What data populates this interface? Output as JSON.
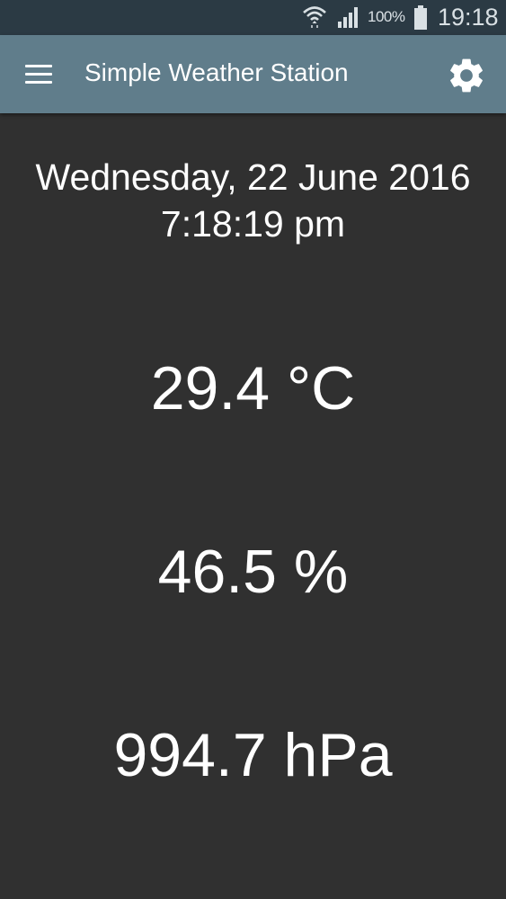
{
  "status_bar": {
    "battery_percent": "100%",
    "time": "19:18",
    "icons": [
      "wifi-icon",
      "signal-icon",
      "battery-icon"
    ]
  },
  "app_bar": {
    "title": "Simple Weather Station",
    "menu_icon": "menu-icon",
    "settings_icon": "gear-icon",
    "color": "#607d8b"
  },
  "main": {
    "date": "Wednesday, 22 June 2016",
    "time": "7:18:19 pm",
    "temperature": "29.4 °C",
    "humidity": "46.5 %",
    "pressure": "994.7 hPa"
  },
  "colors": {
    "background": "#303030",
    "status_bar": "#2b3a44",
    "text": "#ffffff"
  }
}
